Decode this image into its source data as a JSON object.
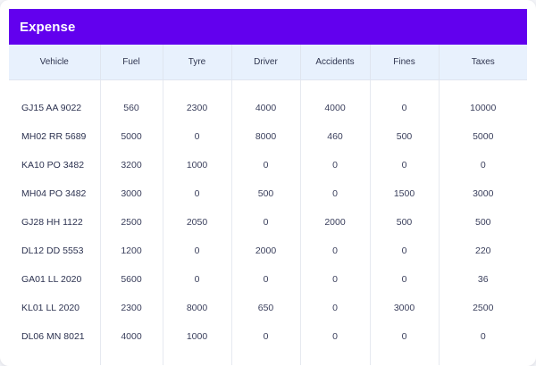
{
  "panel": {
    "title": "Expense"
  },
  "table": {
    "columns": [
      "Vehicle",
      "Fuel",
      "Tyre",
      "Driver",
      "Accidents",
      "Fines",
      "Taxes"
    ],
    "rows": [
      [
        "GJ15 AA 9022",
        "560",
        "2300",
        "4000",
        "4000",
        "0",
        "10000"
      ],
      [
        "MH02 RR 5689",
        "5000",
        "0",
        "8000",
        "460",
        "500",
        "5000"
      ],
      [
        "KA10 PO 3482",
        "3200",
        "1000",
        "0",
        "0",
        "0",
        "0"
      ],
      [
        "MH04 PO 3482",
        "3000",
        "0",
        "500",
        "0",
        "1500",
        "3000"
      ],
      [
        "GJ28 HH 1122",
        "2500",
        "2050",
        "0",
        "2000",
        "500",
        "500"
      ],
      [
        "DL12 DD 5553",
        "1200",
        "0",
        "2000",
        "0",
        "0",
        "220"
      ],
      [
        "GA01 LL 2020",
        "5600",
        "0",
        "0",
        "0",
        "0",
        "36"
      ],
      [
        "KL01 LL 2020",
        "2300",
        "8000",
        "650",
        "0",
        "3000",
        "2500"
      ],
      [
        "DL06 MN 8021",
        "4000",
        "1000",
        "0",
        "0",
        "0",
        "0"
      ]
    ]
  },
  "colors": {
    "header_bg": "#6200ee",
    "column_header_bg": "#e8f1fd"
  }
}
